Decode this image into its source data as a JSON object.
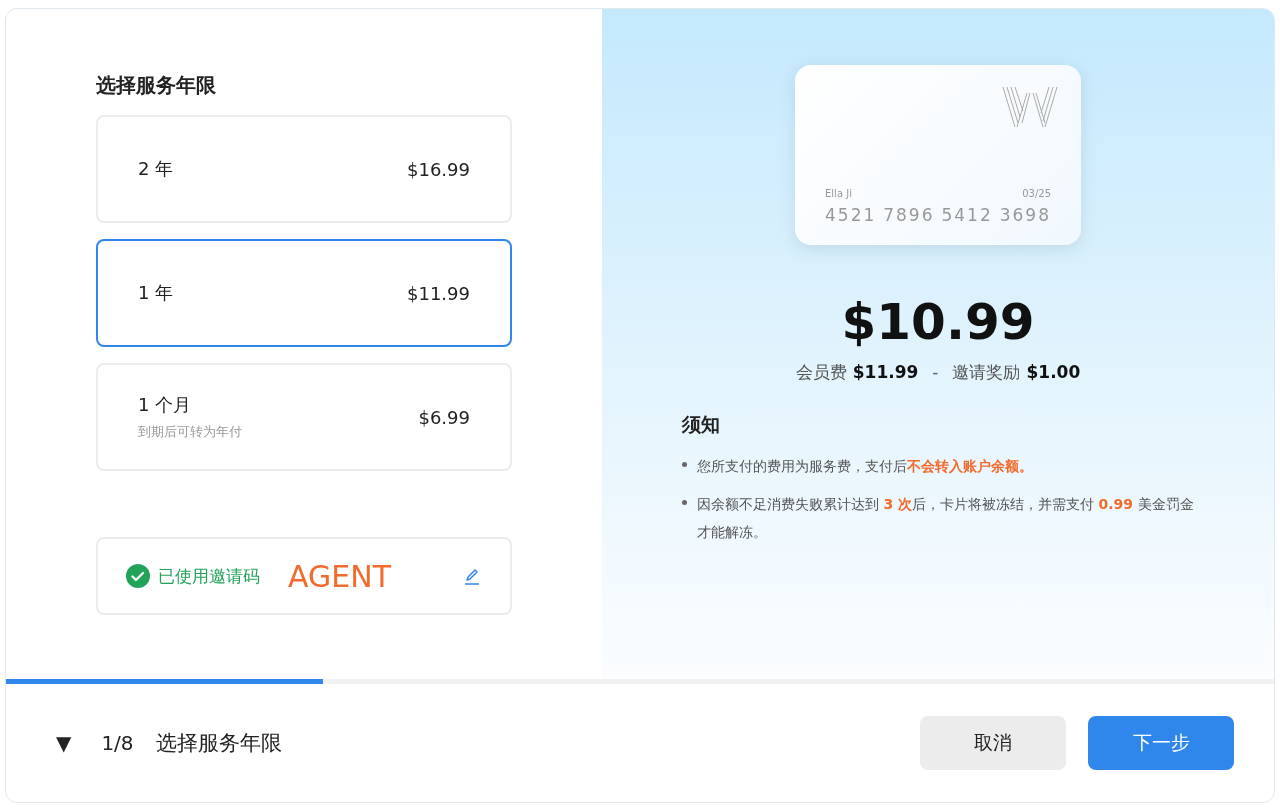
{
  "section_title": "选择服务年限",
  "plans": [
    {
      "label": "2 年",
      "price": "$16.99",
      "selected": false
    },
    {
      "label": "1 年",
      "price": "$11.99",
      "selected": true
    },
    {
      "label": "1 个月",
      "note": "到期后可转为年付",
      "price": "$6.99",
      "selected": false
    }
  ],
  "invite": {
    "status": "已使用邀请码",
    "code": "AGENT",
    "applied": true
  },
  "card": {
    "holder": "Ella Ji",
    "expiry": "03/25",
    "number": [
      "4521",
      "7896",
      "5412",
      "3698"
    ]
  },
  "total": "$10.99",
  "breakdown": {
    "fee_label": "会员费",
    "fee": "$11.99",
    "separator": "-",
    "reward_label": "邀请奖励",
    "reward": "$1.00"
  },
  "notice": {
    "title": "须知",
    "items": [
      "您所支付的费用为服务费，支付后**不会转入账户余额。**",
      "因余额不足消费失败累计达到 **3 次**后，卡片将被冻结，并需支付 **0.99** 美金罚金才能解冻。"
    ]
  },
  "progress": {
    "level": 0.25
  },
  "footer": {
    "toggle": "▼",
    "step": "1/8",
    "step_title": "选择服务年限",
    "buttons": [
      {
        "label": "取消",
        "kind": "secondary"
      },
      {
        "label": "下一步",
        "kind": "primary"
      }
    ]
  }
}
